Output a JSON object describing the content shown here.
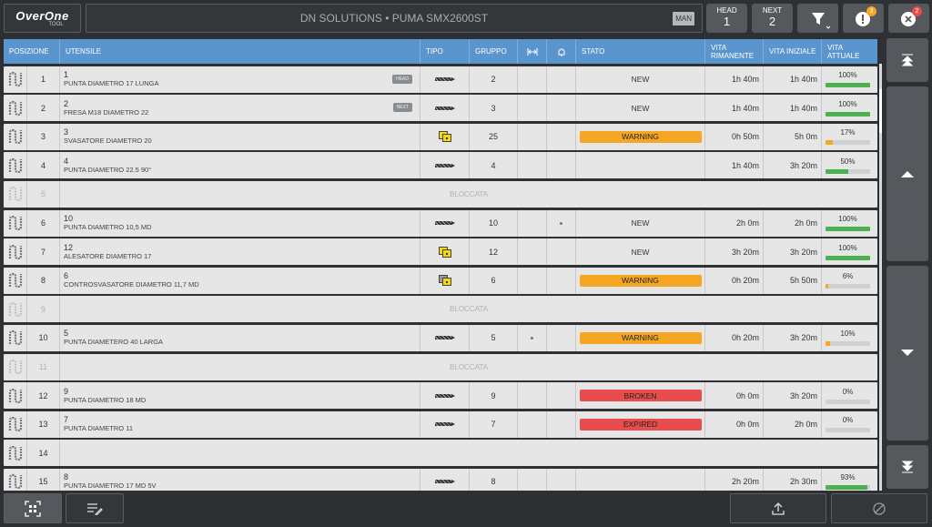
{
  "app": {
    "logo_main": "OverOne",
    "logo_sub": "TOOL"
  },
  "header": {
    "machine": "DN SOLUTIONS • PUMA SMX2600ST",
    "mode": "MAN",
    "head": {
      "caption": "HEAD",
      "value": "1"
    },
    "next": {
      "caption": "NEXT",
      "value": "2"
    },
    "warnings_count": "3",
    "errors_count": "2"
  },
  "columns": {
    "posizione": "POSIZIONE",
    "utensile": "UTENSILE",
    "tipo": "TIPO",
    "gruppo": "GRUPPO",
    "stato": "STATO",
    "vita_rimanente": "VITA RIMANENTE",
    "vita_iniziale": "VITA INIZIALE",
    "vita_attuale": "VITA ATTUALE"
  },
  "locked_label": "BLOCCATA",
  "colors": {
    "header": "#5b95cd",
    "warning": "#f5a623",
    "broken": "#e84c4c",
    "progress_ok": "#4caf50",
    "progress_low": "#f5a623"
  },
  "rows": [
    {
      "pos": "1",
      "num": "1",
      "name": "PUNTA DIAMETRO 17 LUNGA",
      "badge": "HEAD",
      "tipo": "drill",
      "gruppo": "2",
      "dot": false,
      "stato": "NEW",
      "stato_style": "",
      "rim": "1h 40m",
      "ini": "1h 40m",
      "pct": "100%",
      "fill": 1.0,
      "fill_color": "#4caf50"
    },
    {
      "pos": "2",
      "num": "2",
      "name": "FRESA M18 DIAMETRO 22",
      "badge": "NEXT",
      "tipo": "drill",
      "gruppo": "3",
      "dot": false,
      "stato": "NEW",
      "stato_style": "",
      "rim": "1h 40m",
      "ini": "1h 40m",
      "pct": "100%",
      "fill": 1.0,
      "fill_color": "#4caf50"
    },
    {
      "pos": "3",
      "num": "3",
      "name": "SVASATORE DIAMETRO 20",
      "badge": "",
      "tipo": "square",
      "gruppo": "25",
      "dot": false,
      "stato": "WARNING",
      "stato_style": "warning",
      "rim": "0h 50m",
      "ini": "5h 0m",
      "pct": "17%",
      "fill": 0.17,
      "fill_color": "#f5a623"
    },
    {
      "pos": "4",
      "num": "4",
      "name": "PUNTA DIAMETRO 22.5 90°",
      "badge": "",
      "tipo": "drill",
      "gruppo": "4",
      "dot": false,
      "stato": "",
      "stato_style": "",
      "rim": "1h 40m",
      "ini": "3h 20m",
      "pct": "50%",
      "fill": 0.5,
      "fill_color": "#4caf50"
    },
    {
      "pos": "5",
      "locked": true
    },
    {
      "pos": "6",
      "num": "10",
      "name": "PUNTA DIAMETRO 10,5 MD",
      "badge": "",
      "tipo": "drill",
      "gruppo": "10",
      "dot": true,
      "stato": "NEW",
      "stato_style": "",
      "rim": "2h 0m",
      "ini": "2h 0m",
      "pct": "100%",
      "fill": 1.0,
      "fill_color": "#4caf50"
    },
    {
      "pos": "7",
      "num": "12",
      "name": "ALESATORE DIAMETRO 17",
      "badge": "",
      "tipo": "square",
      "gruppo": "12",
      "dot": false,
      "stato": "NEW",
      "stato_style": "",
      "rim": "3h 20m",
      "ini": "3h 20m",
      "pct": "100%",
      "fill": 1.0,
      "fill_color": "#4caf50"
    },
    {
      "pos": "8",
      "num": "6",
      "name": "CONTROSVASATORE DIAMETRO 11,7 MD",
      "badge": "",
      "tipo": "square-grey",
      "gruppo": "6",
      "dot": false,
      "stato": "WARNING",
      "stato_style": "warning",
      "rim": "0h 20m",
      "ini": "5h 50m",
      "pct": "6%",
      "fill": 0.06,
      "fill_color": "#f5a623"
    },
    {
      "pos": "9",
      "locked": true
    },
    {
      "pos": "10",
      "num": "5",
      "name": "PUNTA DIAMETERO 40 LARGA",
      "badge": "",
      "tipo": "drill",
      "gruppo": "5",
      "dot": true,
      "dot_col": "a",
      "stato": "WARNING",
      "stato_style": "warning",
      "rim": "0h 20m",
      "ini": "3h 20m",
      "pct": "10%",
      "fill": 0.1,
      "fill_color": "#f5a623"
    },
    {
      "pos": "11",
      "locked": true
    },
    {
      "pos": "12",
      "num": "9",
      "name": "PUNTA DIAMETRO 18 MD",
      "badge": "",
      "tipo": "drill",
      "gruppo": "9",
      "dot": false,
      "stato": "BROKEN",
      "stato_style": "broken",
      "rim": "0h 0m",
      "ini": "3h 20m",
      "pct": "0%",
      "fill": 0,
      "fill_color": "#4caf50"
    },
    {
      "pos": "13",
      "num": "7",
      "name": "PUNTA DIAMETRO 11",
      "badge": "",
      "tipo": "drill",
      "gruppo": "7",
      "dot": false,
      "stato": "EXPIRED",
      "stato_style": "expired",
      "rim": "0h 0m",
      "ini": "2h 0m",
      "pct": "0%",
      "fill": 0,
      "fill_color": "#4caf50"
    },
    {
      "pos": "14",
      "empty": true
    },
    {
      "pos": "15",
      "num": "8",
      "name": "PUNTA DIAMETRO 17 MD 5V",
      "badge": "",
      "tipo": "drill",
      "gruppo": "8",
      "dot": false,
      "stato": "",
      "stato_style": "",
      "rim": "2h 20m",
      "ini": "2h 30m",
      "pct": "93%",
      "fill": 0.93,
      "fill_color": "#4caf50"
    }
  ]
}
